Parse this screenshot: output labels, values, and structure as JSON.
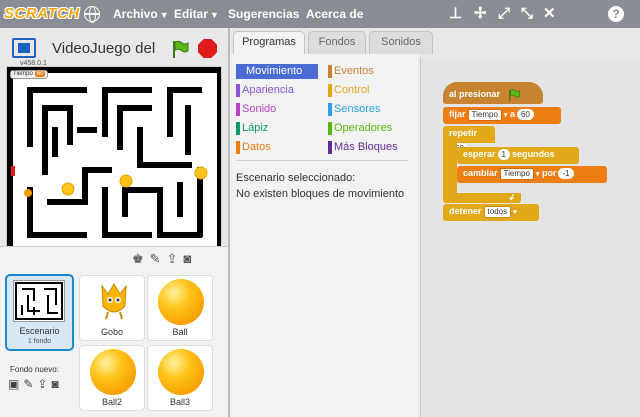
{
  "topbar": {
    "logo": "SCRATCH",
    "menus": [
      "Archivo",
      "Editar",
      "Sugerencias",
      "Acerca de"
    ],
    "help": "?"
  },
  "stage": {
    "project_title": "VideoJuego del",
    "version": "v458.0.1",
    "monitor": {
      "name": "Tiempo",
      "value": "60"
    },
    "x_label": "x:",
    "x_value": "240",
    "y_label": "y:",
    "y_value": "138"
  },
  "sprites": {
    "stage_label": "Escenario",
    "stage_sub": "1 fondo",
    "items": [
      "Gobo",
      "Ball",
      "Ball2",
      "Ball3"
    ],
    "new_backdrop": "Fondo nuevo:"
  },
  "tabs": [
    "Programas",
    "Fondos",
    "Sonidos"
  ],
  "palette": {
    "left": [
      {
        "label": "Movimiento",
        "color": "#4a6cd4"
      },
      {
        "label": "Apariencia",
        "color": "#8a55d7"
      },
      {
        "label": "Sonido",
        "color": "#bb42c3"
      },
      {
        "label": "Lápiz",
        "color": "#0e9a6c"
      },
      {
        "label": "Datos",
        "color": "#ee7d16"
      }
    ],
    "right": [
      {
        "label": "Eventos",
        "color": "#c88330"
      },
      {
        "label": "Control",
        "color": "#e1a91a"
      },
      {
        "label": "Sensores",
        "color": "#2ca5e2"
      },
      {
        "label": "Operadores",
        "color": "#5cb712"
      },
      {
        "label": "Más Bloques",
        "color": "#632d99"
      }
    ],
    "message1": "Escenario seleccionado:",
    "message2": "No existen bloques de movimiento"
  },
  "script": {
    "when_flag": "al presionar",
    "set": "fijar",
    "set_var": "Tiempo",
    "set_to": "a",
    "set_value": "60",
    "repeat": "repetir",
    "repeat_value": "60",
    "wait": "esperar",
    "wait_value": "1",
    "wait_unit": "segundos",
    "change": "cambiar",
    "change_var": "Tiempo",
    "change_by": "por",
    "change_value": "-1",
    "stop": "detener",
    "stop_option": "todos"
  }
}
